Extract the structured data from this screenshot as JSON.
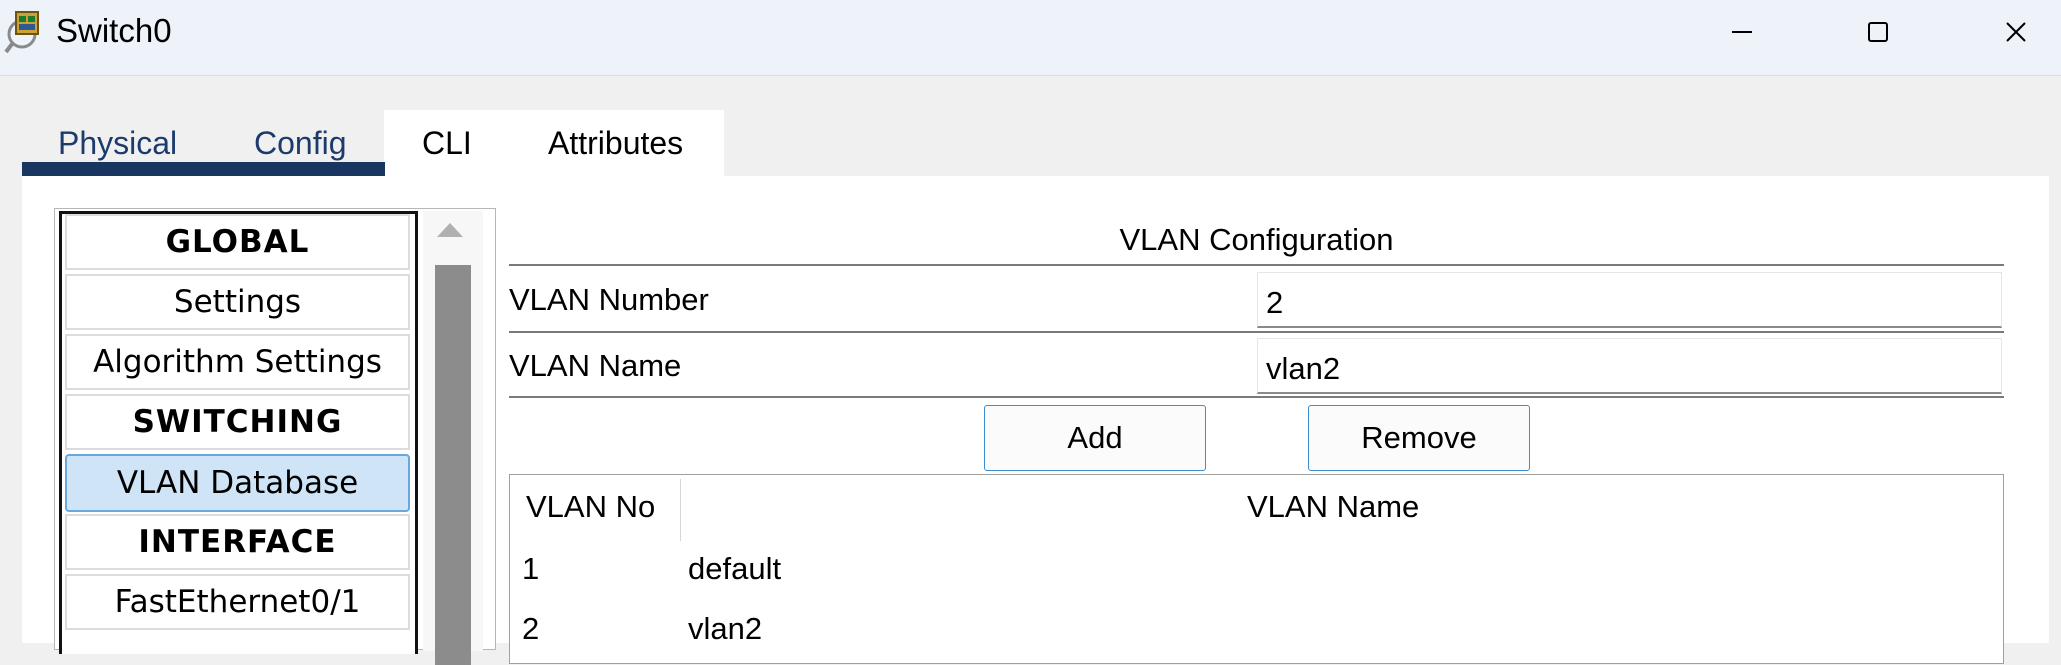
{
  "window": {
    "title": "Switch0",
    "icons": {
      "app": "switch-device-icon",
      "minimize": "minimize-icon",
      "maximize": "maximize-icon",
      "close": "close-icon"
    }
  },
  "tabs": [
    {
      "label": "Physical"
    },
    {
      "label": "Config"
    },
    {
      "label": "CLI"
    },
    {
      "label": "Attributes"
    }
  ],
  "sidebar": {
    "items": [
      {
        "label": "GLOBAL"
      },
      {
        "label": "Settings"
      },
      {
        "label": "Algorithm Settings"
      },
      {
        "label": "SWITCHING"
      },
      {
        "label": "VLAN Database"
      },
      {
        "label": "INTERFACE"
      },
      {
        "label": "FastEthernet0/1"
      }
    ]
  },
  "vlan_panel": {
    "title": "VLAN Configuration",
    "number_label": "VLAN Number",
    "number_value": "2",
    "name_label": "VLAN Name",
    "name_value": "vlan2",
    "add_label": "Add",
    "remove_label": "Remove",
    "table": {
      "headers": [
        "VLAN No",
        "VLAN Name"
      ],
      "rows": [
        [
          "1",
          "default"
        ],
        [
          "2",
          "vlan2"
        ]
      ]
    }
  },
  "colors": {
    "titlebar_bg": "#eef3fa",
    "tab_underline": "#18365f",
    "selected_item_bg": "#cfe4f7",
    "button_border": "#3b8ed0"
  }
}
